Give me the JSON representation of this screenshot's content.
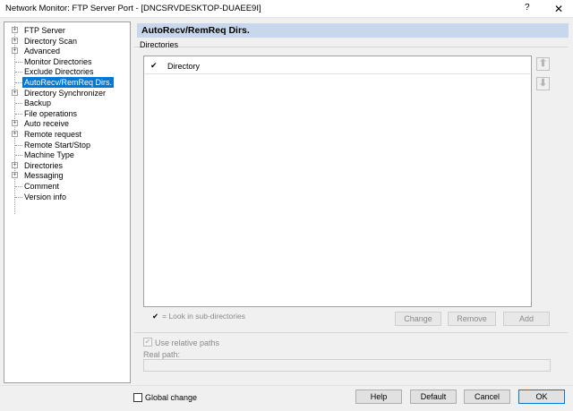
{
  "window": {
    "title": "Network Monitor: FTP Server Port - [DNCSRVDESKTOP-DUAEE9I]",
    "help_glyph": "?",
    "close_glyph": "✕"
  },
  "tree": {
    "items": [
      {
        "label": "FTP Server",
        "expandable": true
      },
      {
        "label": "Directory Scan",
        "expandable": true
      },
      {
        "label": "Advanced",
        "expandable": true
      },
      {
        "label": "Monitor Directories",
        "expandable": false
      },
      {
        "label": "Exclude Directories",
        "expandable": false
      },
      {
        "label": "AutoRecv/RemReq Dirs.",
        "expandable": false,
        "selected": true
      },
      {
        "label": "Directory Synchronizer",
        "expandable": true
      },
      {
        "label": "Backup",
        "expandable": false
      },
      {
        "label": "File operations",
        "expandable": false
      },
      {
        "label": "Auto receive",
        "expandable": true
      },
      {
        "label": "Remote request",
        "expandable": true
      },
      {
        "label": "Remote Start/Stop",
        "expandable": false
      },
      {
        "label": "Machine Type",
        "expandable": false
      },
      {
        "label": "Directories",
        "expandable": true
      },
      {
        "label": "Messaging",
        "expandable": true
      },
      {
        "label": "Comment",
        "expandable": false
      },
      {
        "label": "Version info",
        "expandable": false
      }
    ]
  },
  "panel": {
    "title": "AutoRecv/RemReq Dirs.",
    "group_label": "Directories",
    "list": {
      "check_glyph": "✔",
      "column_label": "Directory"
    },
    "move_up_glyph": "⬆",
    "move_down_glyph": "⬇",
    "legend": {
      "mark": "✔",
      "text": "= Look in sub-directories"
    },
    "buttons": {
      "change": "Change",
      "remove": "Remove",
      "add": "Add"
    },
    "use_relative_paths": {
      "label": "Use relative paths",
      "checked": true,
      "check_glyph": "✔"
    },
    "real_path": {
      "label": "Real path:",
      "value": ""
    }
  },
  "footer": {
    "global_change_label": "Global change",
    "help": "Help",
    "default": "Default",
    "cancel": "Cancel",
    "ok": "OK"
  },
  "colors": {
    "selection": "#0078d7",
    "panel_header": "#c9d7ec"
  }
}
